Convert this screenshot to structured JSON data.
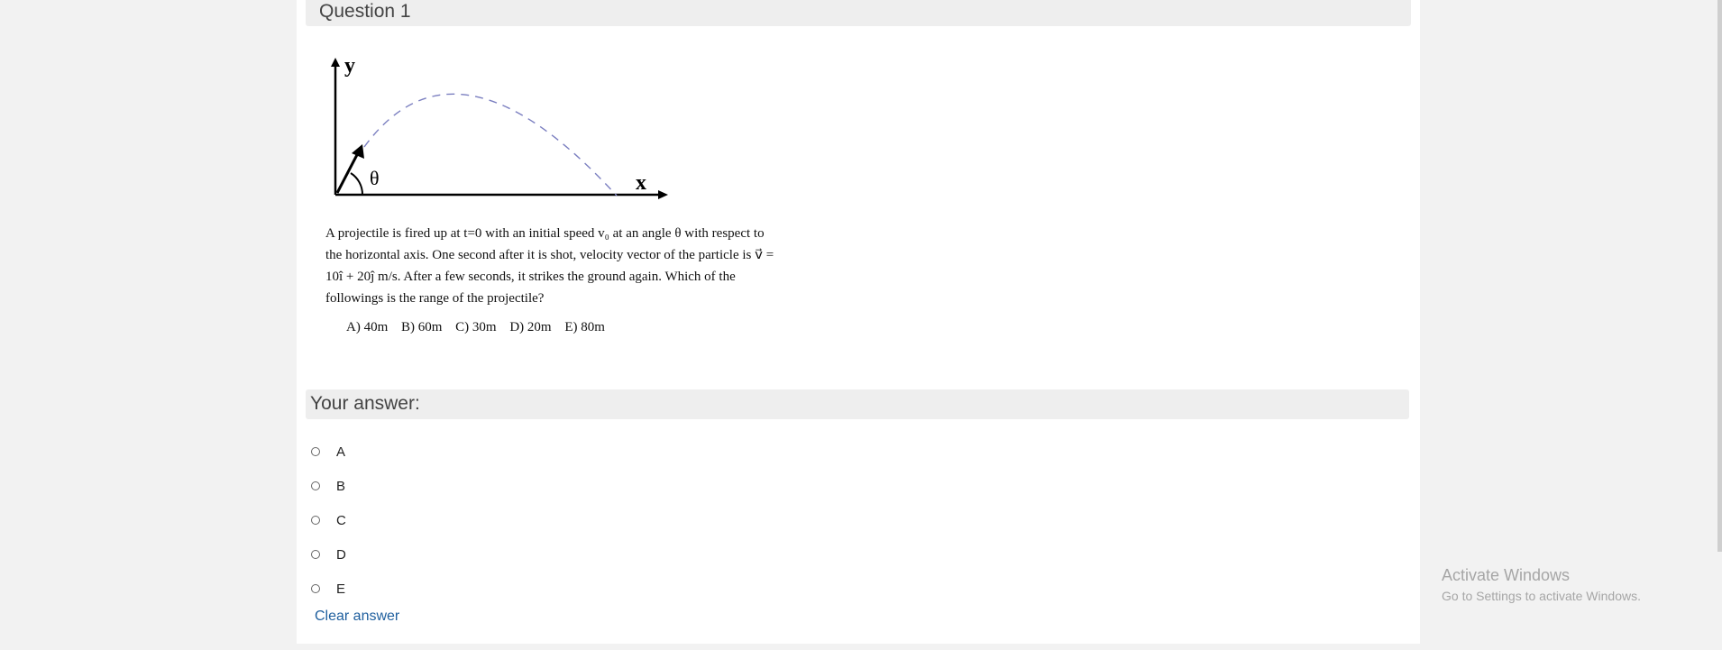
{
  "question": {
    "title": "Question 1",
    "figure": {
      "y_label": "y",
      "x_label": "x",
      "angle_label": "θ"
    },
    "text_lines": [
      "A projectile is fired up at t=0  with an initial speed  v₀ at an angle θ with respect to",
      "the horizontal axis. One second after it is shot, velocity vector of the particle is v⃗ =",
      "10î + 20ĵ m/s. After a few seconds, it strikes the ground again. Which of the",
      "followings is the range of the projectile?"
    ],
    "choices": [
      "A) 40m",
      "B) 60m",
      "C) 30m",
      "D) 20m",
      "E) 80m"
    ]
  },
  "answer": {
    "header": "Your answer:",
    "options": [
      "A",
      "B",
      "C",
      "D",
      "E"
    ],
    "clear_label": "Clear answer"
  },
  "watermark": {
    "title": "Activate Windows",
    "subtitle": "Go to Settings to activate Windows."
  },
  "colors": {
    "trajectory": "#7b7fc0",
    "link": "#1f5f9e",
    "header_bg": "#eeeeee"
  }
}
